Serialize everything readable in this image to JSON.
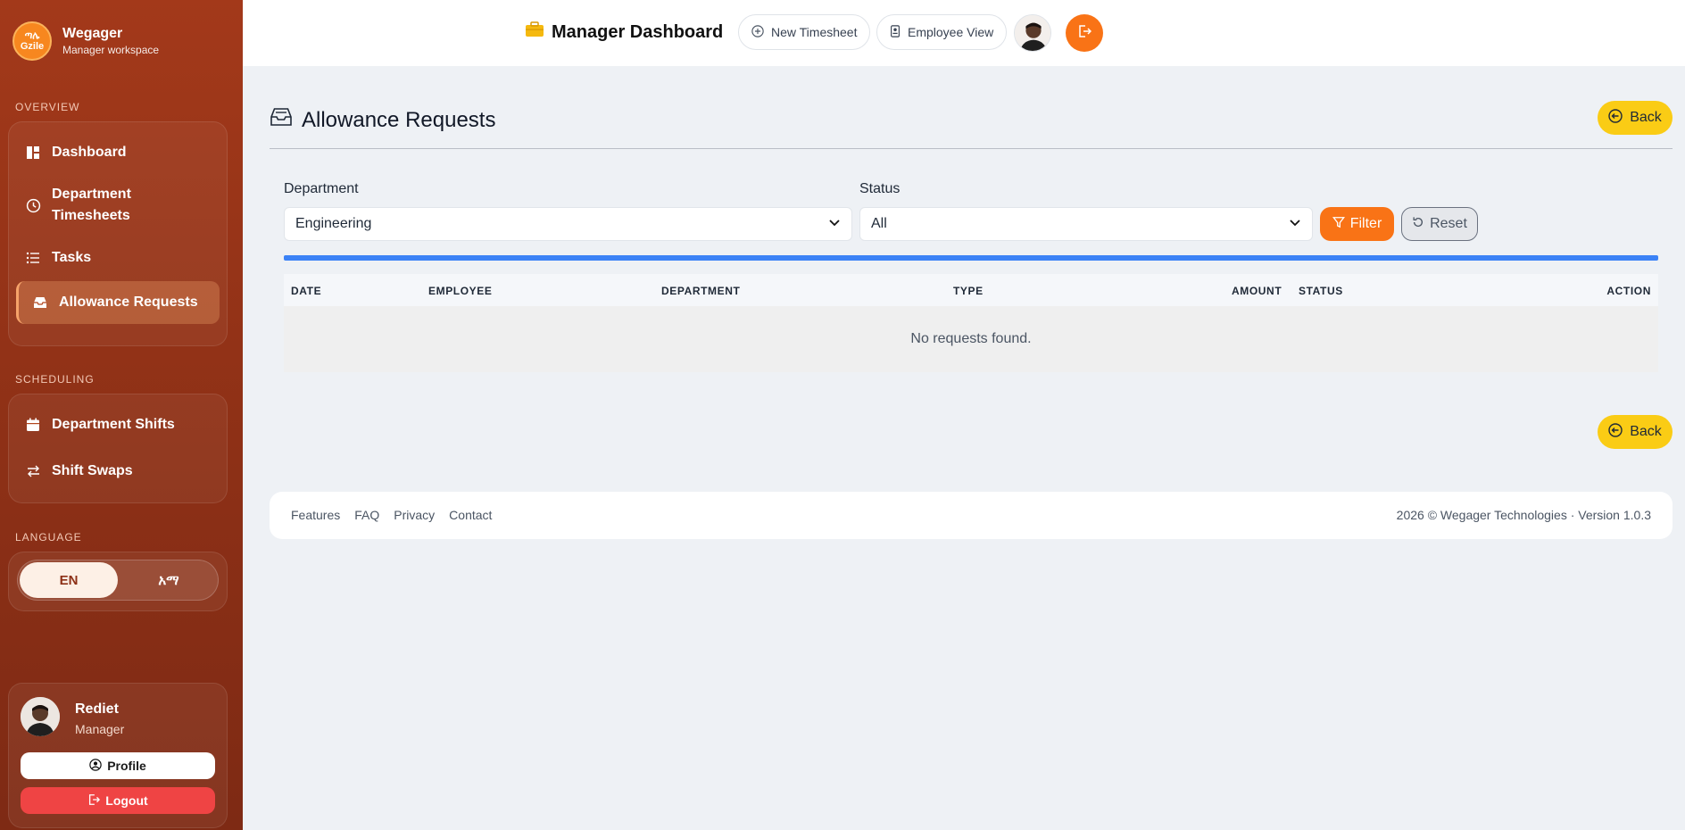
{
  "brand": {
    "logo_text_top": "ጣሌ",
    "logo_text_bottom": "Gzile",
    "name": "Wegager",
    "subtitle": "Manager workspace"
  },
  "sidebar": {
    "sections": [
      {
        "label": "OVERVIEW"
      },
      {
        "label": "SCHEDULING"
      },
      {
        "label": "LANGUAGE"
      }
    ],
    "overview_items": [
      {
        "label": "Dashboard",
        "icon": "dashboard-icon"
      },
      {
        "label": "Department Timesheets",
        "icon": "clock-icon"
      },
      {
        "label": "Tasks",
        "icon": "list-icon"
      },
      {
        "label": "Allowance Requests",
        "icon": "inbox-icon",
        "active": true
      }
    ],
    "scheduling_items": [
      {
        "label": "Department Shifts",
        "icon": "calendar-icon"
      },
      {
        "label": "Shift Swaps",
        "icon": "swap-icon"
      }
    ],
    "language": {
      "options": [
        "EN",
        "አማ"
      ],
      "selected": "EN"
    },
    "user": {
      "name": "Rediet",
      "role": "Manager",
      "profile_label": "Profile",
      "logout_label": "Logout"
    }
  },
  "header": {
    "title": "Manager Dashboard",
    "new_timesheet_label": "New Timesheet",
    "employee_view_label": "Employee View"
  },
  "main": {
    "title": "Allowance Requests",
    "back_label": "Back",
    "filters": {
      "department_label": "Department",
      "department_value": "Engineering",
      "status_label": "Status",
      "status_value": "All",
      "filter_label": "Filter",
      "reset_label": "Reset"
    },
    "table": {
      "columns": [
        "DATE",
        "EMPLOYEE",
        "DEPARTMENT",
        "TYPE",
        "AMOUNT",
        "STATUS",
        "ACTION"
      ],
      "empty_message": "No requests found."
    }
  },
  "footer": {
    "links": [
      "Features",
      "FAQ",
      "Privacy",
      "Contact"
    ],
    "copyright": "2026 © Wegager Technologies · Version 1.0.3"
  },
  "colors": {
    "sidebar": "#8d3016",
    "accent_orange": "#f97316",
    "back_yellow": "#facc15",
    "progress_blue": "#3b82f6",
    "logout_red": "#ef4444"
  }
}
